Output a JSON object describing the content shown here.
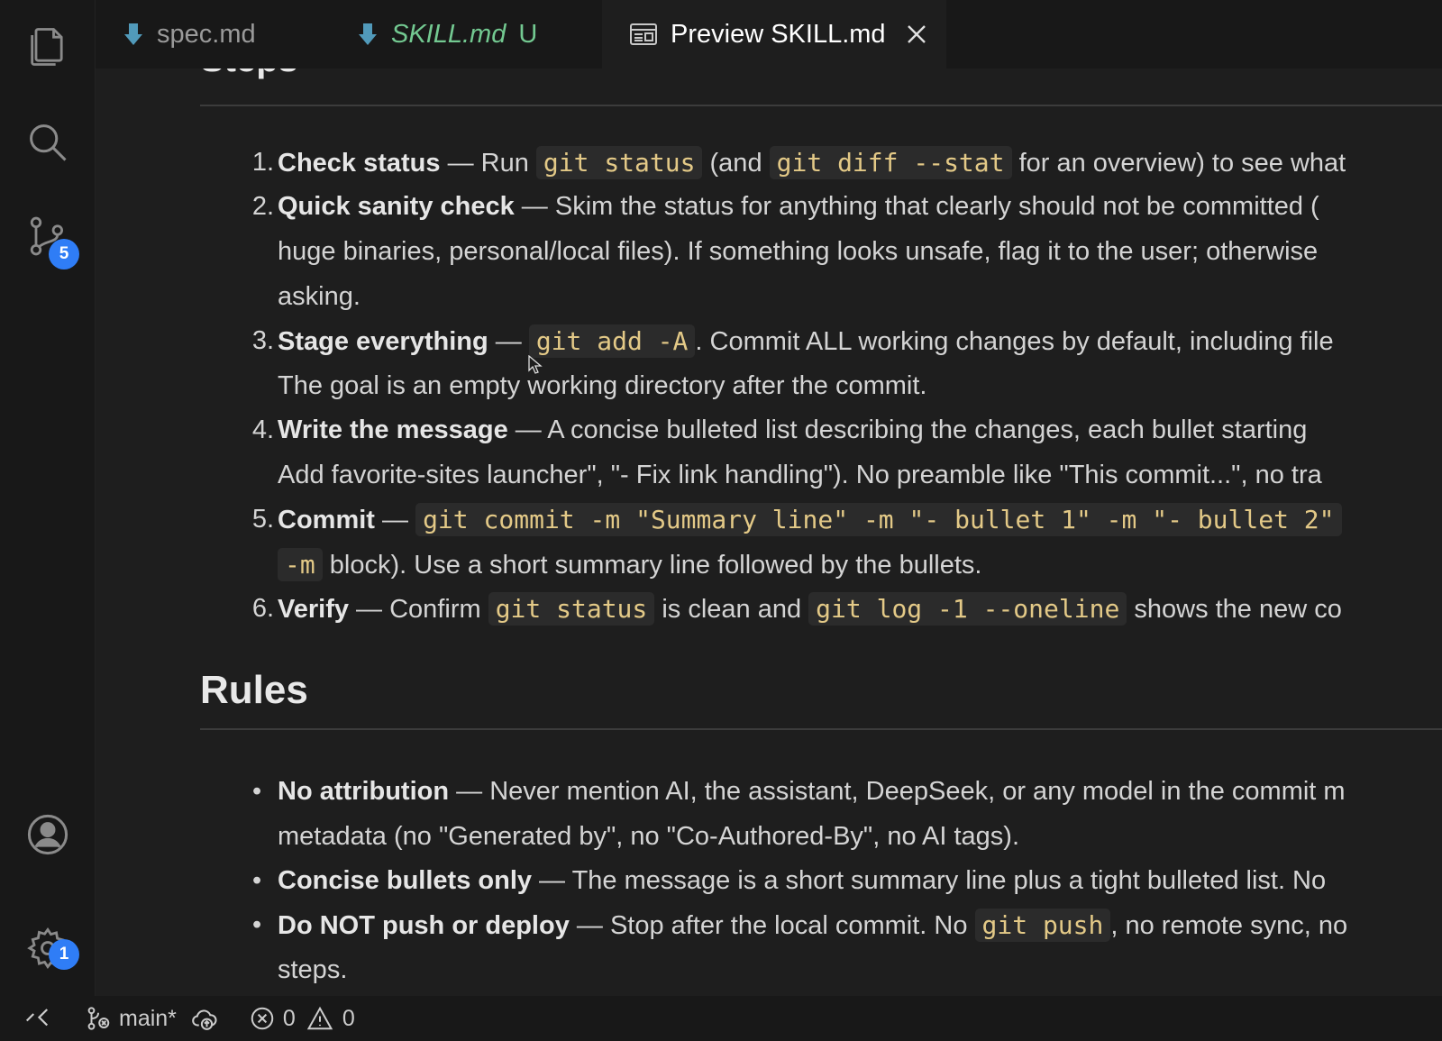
{
  "activity_bar": {
    "items": [
      {
        "icon": "files-icon"
      },
      {
        "icon": "search-icon"
      },
      {
        "icon": "source-control-icon",
        "badge": "5"
      },
      {
        "icon": "account-icon"
      },
      {
        "icon": "gear-icon",
        "badge": "1"
      }
    ]
  },
  "tabs": [
    {
      "label": "spec.md",
      "state": "inactive"
    },
    {
      "label": "SKILL.md",
      "status": "U",
      "state": "inactive"
    },
    {
      "label": "Preview SKILL.md",
      "state": "active"
    }
  ],
  "content": {
    "steps_heading": "Steps",
    "steps": [
      {
        "num": "1.",
        "title": "Check status",
        "sep": " — Run ",
        "code1": "git status",
        "mid1": " (and ",
        "code2": "git diff --stat",
        "tail": " for an overview) to see what"
      },
      {
        "num": "2.",
        "title": "Quick sanity check",
        "sep": " — Skim the status for anything that clearly should not be committed (",
        "line2": "huge binaries, personal/local files). If something looks unsafe, flag it to the user; otherwise",
        "line3": "asking."
      },
      {
        "num": "3.",
        "title": "Stage everything",
        "sep": " — ",
        "code1": "git add -A",
        "tail": ". Commit ALL working changes by default, including file",
        "line2": "The goal is an empty working directory after the commit."
      },
      {
        "num": "4.",
        "title": "Write the message",
        "sep": " — A concise bulleted list describing the changes, each bullet starting",
        "line2": "Add favorite-sites launcher\", \"- Fix link handling\"). No preamble like \"This commit...\", no tra"
      },
      {
        "num": "5.",
        "title": "Commit",
        "sep": " — ",
        "code1": "git commit -m \"Summary line\" -m \"- bullet 1\" -m \"- bullet 2\"",
        "line2_code": "-m",
        "line2": " block). Use a short summary line followed by the bullets."
      },
      {
        "num": "6.",
        "title": "Verify",
        "sep": " — Confirm ",
        "code1": "git status",
        "mid1": " is clean and ",
        "code2": "git log -1 --oneline",
        "tail": " shows the new co"
      }
    ],
    "rules_heading": "Rules",
    "rules": [
      {
        "title": "No attribution",
        "text": " — Never mention AI, the assistant, DeepSeek, or any model in the commit m",
        "line2": "metadata (no \"Generated by\", no \"Co-Authored-By\", no AI tags)."
      },
      {
        "title": "Concise bullets only",
        "text": " — The message is a short summary line plus a tight bulleted list. No"
      },
      {
        "title": "Do NOT push or deploy",
        "text": " — Stop after the local commit. No ",
        "code1": "git push",
        "tail": ", no remote sync, no",
        "line2": "steps."
      }
    ]
  },
  "status_bar": {
    "branch": "main*",
    "errors": "0",
    "warnings": "0"
  },
  "colors": {
    "accent_badge": "#2f7df6",
    "untracked_green": "#73c991",
    "code_text": "#e3c987",
    "tab_icon_blue": "#519aba"
  }
}
